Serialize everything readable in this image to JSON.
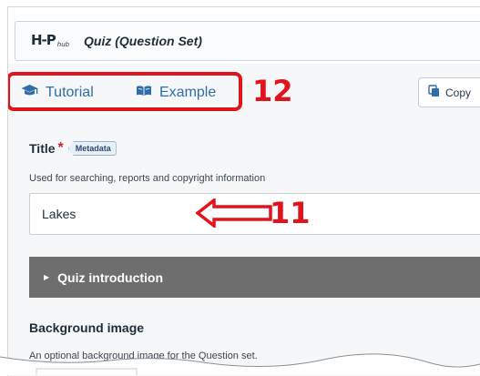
{
  "header": {
    "logo_text": "H-P",
    "logo_sub": "hub",
    "library_title": "Quiz (Question Set)"
  },
  "toolbar": {
    "tutorial_label": "Tutorial",
    "example_label": "Example",
    "copy_label": "Copy"
  },
  "annotations": {
    "toolbar_marker": "12",
    "field_marker": "11",
    "color": "#e1141c"
  },
  "title_field": {
    "label": "Title",
    "required_mark": "*",
    "metadata_label": "Metadata",
    "description": "Used for searching, reports and copyright information",
    "value": "Lakes"
  },
  "quiz_intro": {
    "label": "Quiz introduction"
  },
  "background_image": {
    "label": "Background image",
    "description": "An optional background image for the Question set."
  },
  "colors": {
    "link": "#2f6ea8",
    "group_header": "#6e6e6e",
    "panel": "#f6f7f9",
    "required": "#d0232a"
  },
  "icons": [
    "graduation-cap-icon",
    "book-icon",
    "copy-icon",
    "arrow-left-icon",
    "caret-right-icon"
  ]
}
